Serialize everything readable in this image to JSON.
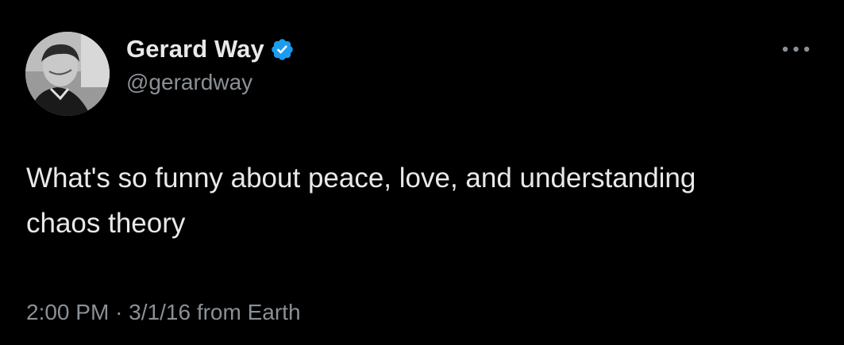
{
  "author": {
    "display_name": "Gerard Way",
    "handle": "@gerardway",
    "verified": true,
    "verified_color": "#1d9bf0"
  },
  "tweet": {
    "text_lines": [
      "What's so funny about peace, love, and understanding",
      "chaos theory"
    ],
    "time": "2:00 PM",
    "separator": "·",
    "date": "3/1/16",
    "source": "from Earth"
  },
  "icons": {
    "more": "more-horizontal-icon",
    "verified": "verified-badge-icon"
  },
  "colors": {
    "background": "#000000",
    "primary_text": "#e7e9ea",
    "secondary_text": "#8b9096",
    "accent": "#1d9bf0"
  }
}
